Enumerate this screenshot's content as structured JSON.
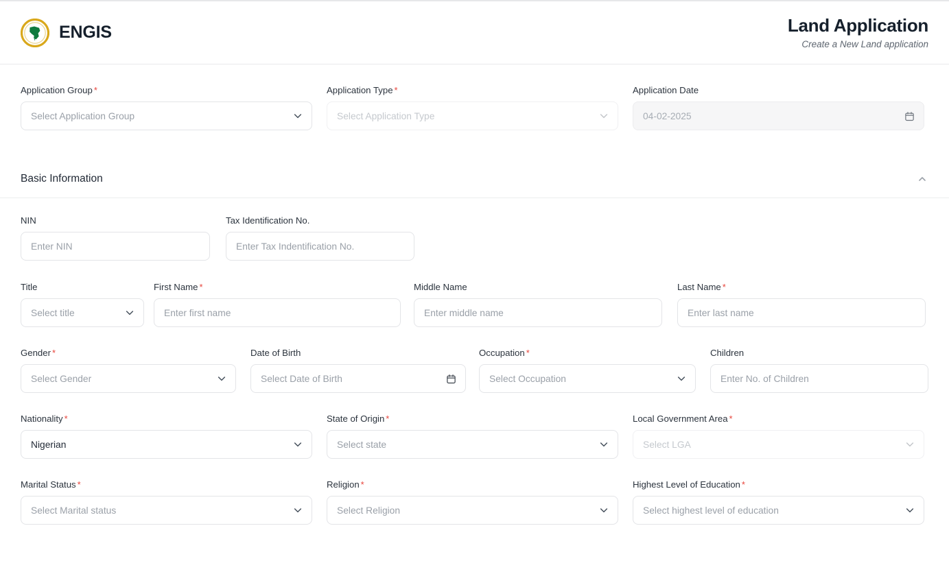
{
  "brand": {
    "name": "ENGIS",
    "logo_icon": "engis-circular-emblem-icon"
  },
  "header": {
    "title": "Land Application",
    "subtitle": "Create a New Land application"
  },
  "colors": {
    "required_asterisk": "#e8453c",
    "logo_ring": "#d9a81b",
    "logo_map": "#0f7a3d",
    "border": "#e3e4e7",
    "placeholder": "#9aa0a8",
    "text": "#1f2733"
  },
  "top_row": [
    {
      "label": "Application Group",
      "required": true,
      "placeholder": "Select Application Group",
      "value": "",
      "control": "select",
      "state": "enabled",
      "icon": "chevron-down-icon"
    },
    {
      "label": "Application Type",
      "required": true,
      "placeholder": "Select Application Type",
      "value": "",
      "control": "select",
      "state": "faded",
      "icon": "chevron-down-icon"
    },
    {
      "label": "Application Date",
      "required": false,
      "placeholder": "",
      "value": "04-02-2025",
      "control": "date",
      "state": "disabled",
      "icon": "calendar-icon"
    }
  ],
  "section": {
    "title": "Basic Information",
    "collapse_icon": "chevron-up-icon",
    "expanded": true
  },
  "rows": {
    "identification": [
      {
        "label": "NIN",
        "required": false,
        "placeholder": "Enter NIN",
        "value": "",
        "control": "text",
        "state": "enabled",
        "icon": ""
      },
      {
        "label": "Tax Identification No.",
        "required": false,
        "placeholder": "Enter Tax Indentification No.",
        "value": "",
        "control": "text",
        "state": "enabled",
        "icon": ""
      }
    ],
    "name": [
      {
        "label": "Title",
        "required": false,
        "placeholder": "Select title",
        "value": "",
        "control": "select",
        "state": "enabled",
        "icon": "chevron-down-icon"
      },
      {
        "label": "First Name",
        "required": true,
        "placeholder": "Enter first name",
        "value": "",
        "control": "text",
        "state": "enabled",
        "icon": ""
      },
      {
        "label": "Middle Name",
        "required": false,
        "placeholder": "Enter middle name",
        "value": "",
        "control": "text",
        "state": "enabled",
        "icon": ""
      },
      {
        "label": "Last Name",
        "required": true,
        "placeholder": "Enter last name",
        "value": "",
        "control": "text",
        "state": "enabled",
        "icon": ""
      }
    ],
    "personal": [
      {
        "label": "Gender",
        "required": true,
        "placeholder": "Select Gender",
        "value": "",
        "control": "select",
        "state": "enabled",
        "icon": "chevron-down-icon"
      },
      {
        "label": "Date of Birth",
        "required": false,
        "placeholder": "Select Date of Birth",
        "value": "",
        "control": "date",
        "state": "enabled",
        "icon": "calendar-icon"
      },
      {
        "label": "Occupation",
        "required": true,
        "placeholder": "Select Occupation",
        "value": "",
        "control": "select",
        "state": "enabled",
        "icon": "chevron-down-icon"
      },
      {
        "label": "Children",
        "required": false,
        "placeholder": "Enter No. of Children",
        "value": "",
        "control": "text",
        "state": "enabled",
        "icon": ""
      }
    ],
    "origin": [
      {
        "label": "Nationality",
        "required": true,
        "placeholder": "",
        "value": "Nigerian",
        "control": "select",
        "state": "filled",
        "icon": "chevron-down-icon"
      },
      {
        "label": "State of Origin",
        "required": true,
        "placeholder": "Select state",
        "value": "",
        "control": "select",
        "state": "enabled",
        "icon": "chevron-down-icon"
      },
      {
        "label": "Local Government Area",
        "required": true,
        "placeholder": "Select LGA",
        "value": "",
        "control": "select",
        "state": "faded",
        "icon": "chevron-down-icon"
      }
    ],
    "background": [
      {
        "label": "Marital Status",
        "required": true,
        "placeholder": "Select Marital status",
        "value": "",
        "control": "select",
        "state": "enabled",
        "icon": "chevron-down-icon"
      },
      {
        "label": "Religion",
        "required": true,
        "placeholder": "Select Religion",
        "value": "",
        "control": "select",
        "state": "enabled",
        "icon": "chevron-down-icon"
      },
      {
        "label": "Highest Level of Education",
        "required": true,
        "placeholder": "Select highest level of education",
        "value": "",
        "control": "select",
        "state": "enabled",
        "icon": "chevron-down-icon"
      }
    ]
  }
}
